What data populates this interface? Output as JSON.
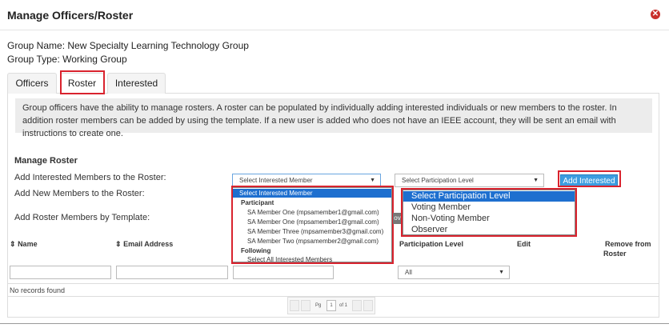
{
  "dialog": {
    "title": "Manage Officers/Roster",
    "close_glyph": "✕"
  },
  "group": {
    "name": "Group Name: New Specialty Learning Technology Group",
    "type": "Group Type: Working Group"
  },
  "tabs": [
    {
      "label": "Officers"
    },
    {
      "label": "Roster"
    },
    {
      "label": "Interested"
    }
  ],
  "info_text": "Group officers have the ability to manage rosters. A roster can be populated by individually adding interested individuals or new members to the roster. In addition roster members can be added by using the template. If a new user is added who does not have an IEEE account, they will be sent an email with instructions to create one.",
  "manage_roster": {
    "heading": "Manage Roster",
    "add_interested_label": "Add Interested Members to the Roster:",
    "add_new_label": "Add New Members to the Roster:",
    "add_template_label": "Add Roster Members by Template:",
    "interested_select_value": "Select Interested Member",
    "participation_select_value": "Select Participation Level",
    "add_interested_button": "Add Interested",
    "overflow_fragment": "ov"
  },
  "interested_dropdown": {
    "selected": "Select Interested Member",
    "group_participant": "Participant",
    "participants": [
      "SA Member One (mpsamember1@gmail.com)",
      "SA Member One (mpsamember1@gmail.com)",
      "SA Member Three (mpsamember3@gmail.com)",
      "SA Member Two (mpsamember2@gmail.com)"
    ],
    "group_following": "Following",
    "following_item": "Select All Interested Members"
  },
  "participation_dropdown": {
    "selected": "Select Participation Level",
    "options": [
      "Voting Member",
      "Non-Voting Member",
      "Observer"
    ]
  },
  "table": {
    "col_name": "Name",
    "col_email": "Email Address",
    "col_level": "Participation Level",
    "col_edit": "Edit",
    "col_remove_1": "Remove from",
    "col_remove_2": "Roster",
    "sort_glyph": "⇕",
    "level_filter_value": "All",
    "no_records": "No records found"
  },
  "pager": {
    "pg_label": "Pg",
    "page": "1",
    "of_label": "of 1"
  },
  "colors": {
    "accent": "#3c9de0",
    "highlight": "#d9232e",
    "selected": "#1e6fcf"
  }
}
